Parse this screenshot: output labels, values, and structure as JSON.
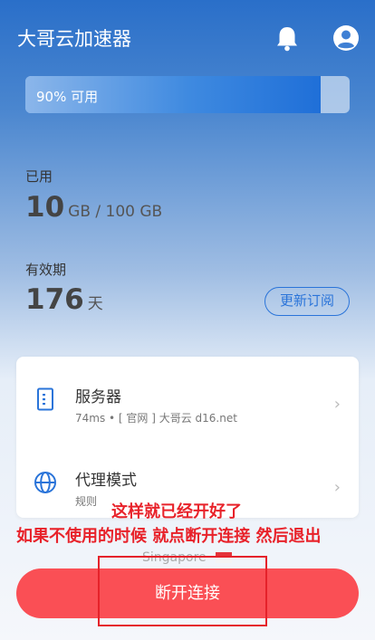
{
  "header": {
    "title": "大哥云加速器",
    "icons": [
      "bell-icon",
      "user-icon"
    ]
  },
  "usage": {
    "text": "90% 可用",
    "available_fraction": 0.91
  },
  "used": {
    "label": "已用",
    "value": "10",
    "unit": "GB / 100 GB"
  },
  "validity": {
    "label": "有效期",
    "value": "176",
    "unit": "天",
    "renew_label": "更新订阅"
  },
  "server": {
    "title": "服务器",
    "detail": "74ms • [ 官网 ] 大哥云 d16.net"
  },
  "proxy": {
    "title": "代理模式",
    "mode": "规则"
  },
  "annotations": {
    "line1": "这样就已经开好了",
    "line2": "如果不使用的时候  就点断开连接 然后退出"
  },
  "location": {
    "name": "Singapore"
  },
  "disconnect_label": "断开连接",
  "colors": {
    "accent": "#2a74d9",
    "danger": "#fa4f55",
    "annotation": "#e8222a"
  }
}
